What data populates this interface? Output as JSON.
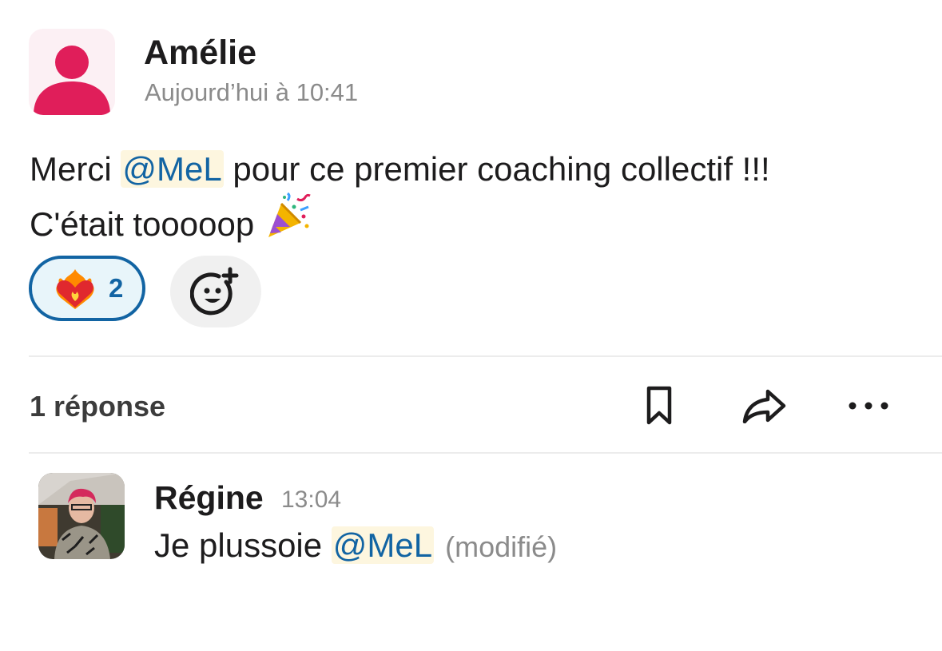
{
  "message": {
    "author": "Amélie",
    "timestamp": "Aujourd’hui à 10:41",
    "text_before_mention": "Merci ",
    "mention": "@MeL",
    "text_after_mention": " pour ce premier coaching collectif !!!",
    "line2": "C'était tooooop ",
    "line2_emoji": "party-popper-icon"
  },
  "reactions": [
    {
      "emoji": "heart-on-fire-icon",
      "count": "2"
    }
  ],
  "add_reaction_icon": "add-reaction-icon",
  "thread": {
    "replies_label": "1 réponse",
    "actions": [
      "bookmark-icon",
      "share-icon",
      "more-icon"
    ]
  },
  "reply": {
    "author": "Régine",
    "timestamp": "13:04",
    "text_before_mention": "Je plussoie ",
    "mention": "@MeL",
    "edited_label": "(modifié)"
  },
  "colors": {
    "mention_text": "#1264a3",
    "mention_bg": "#fdf6df",
    "avatar_accent": "#e01e5a",
    "reaction_border": "#1264a3"
  }
}
